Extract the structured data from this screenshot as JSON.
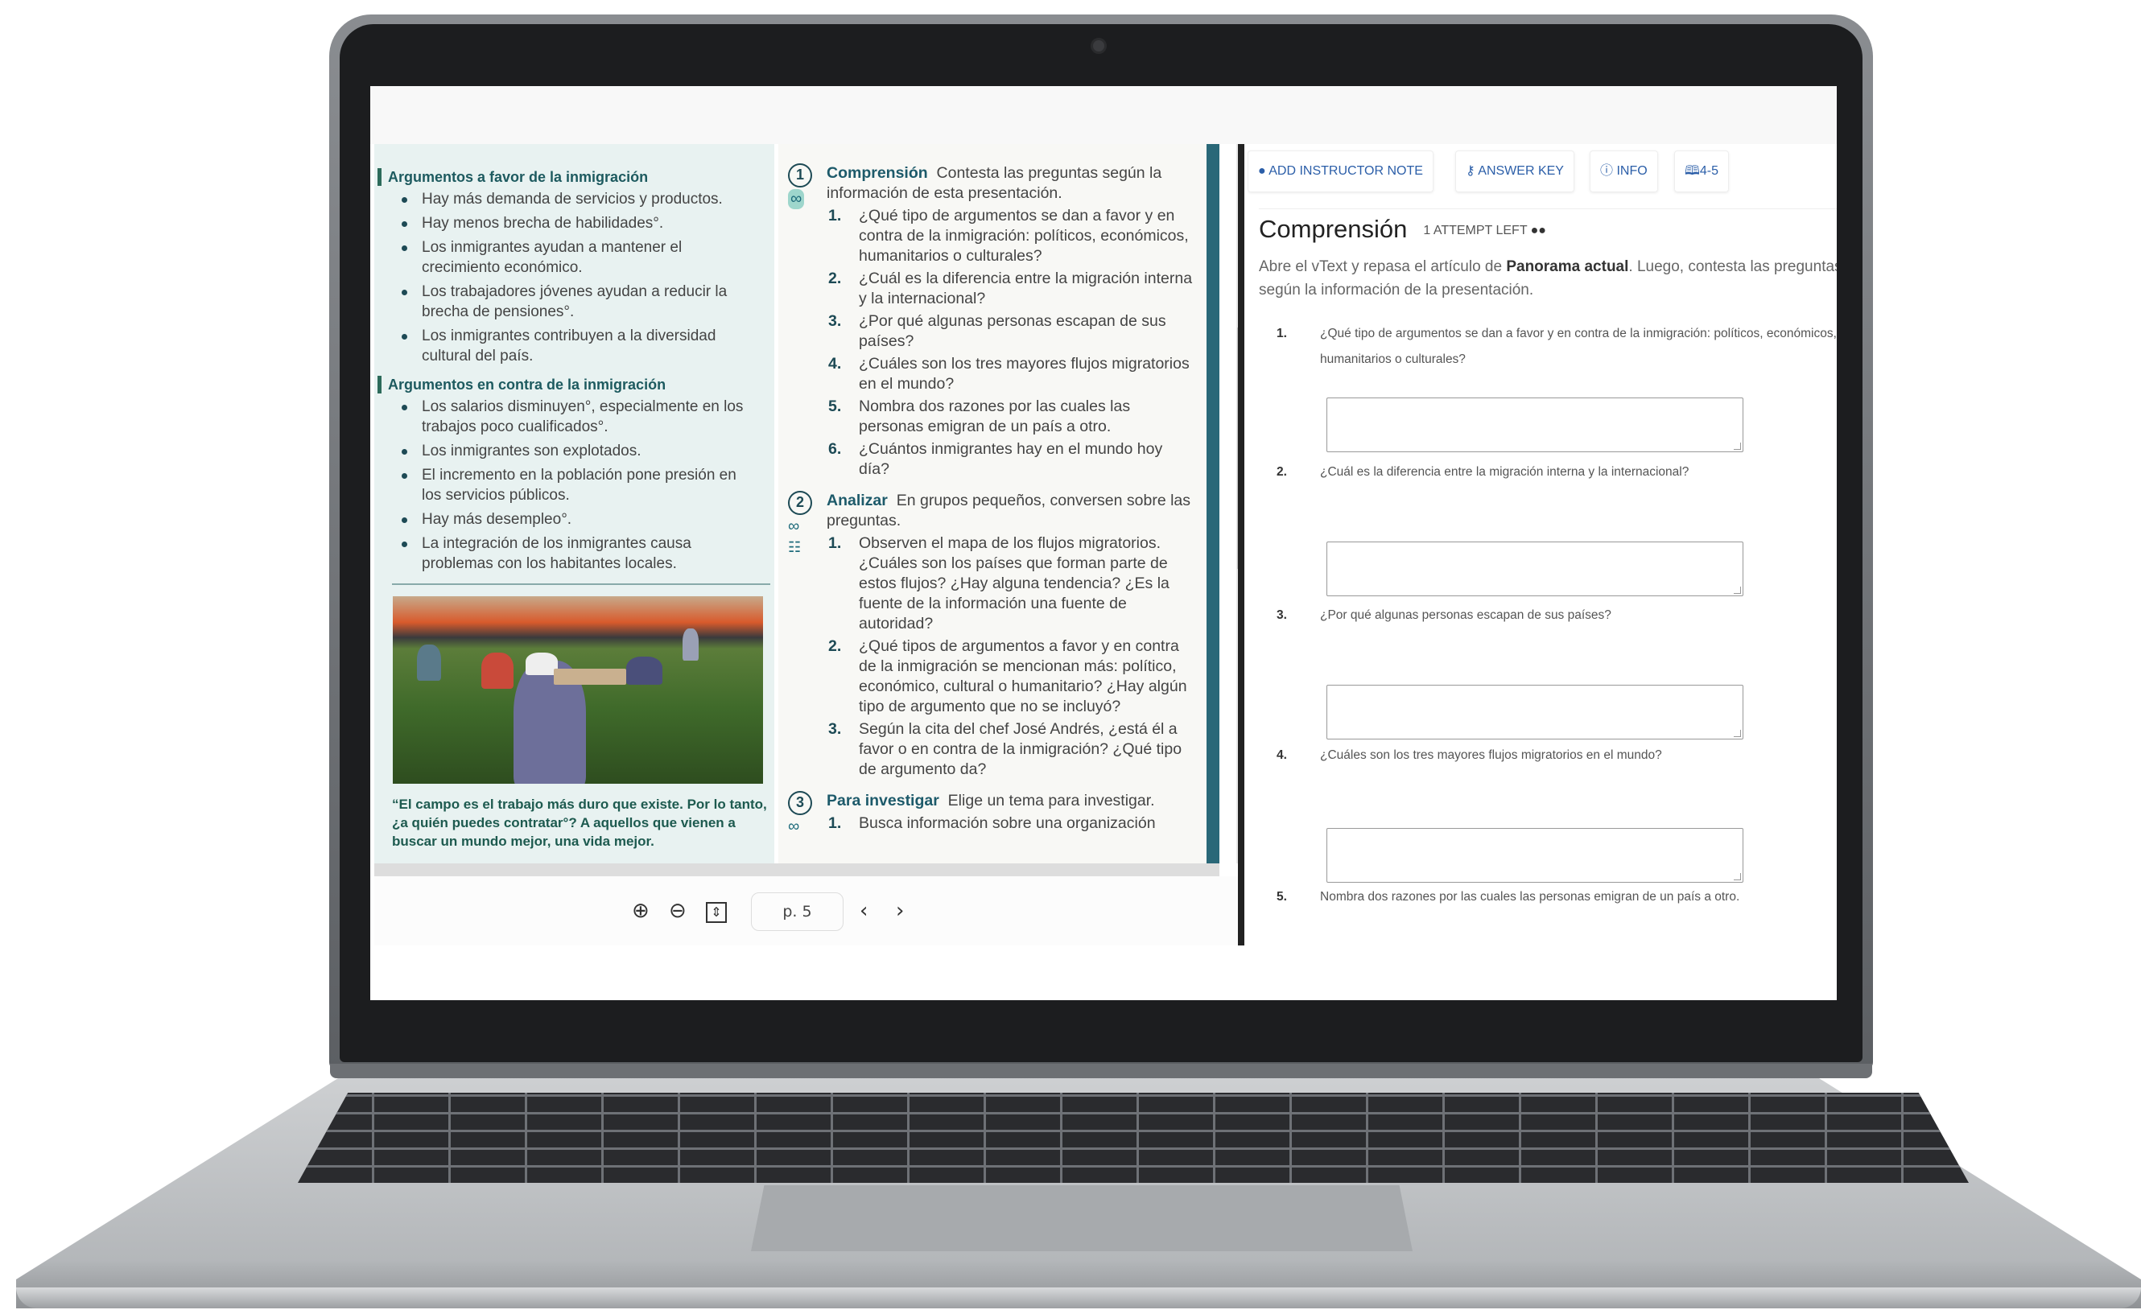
{
  "left_panel": {
    "for_heading": "Argumentos a favor de la inmigración",
    "for_items": [
      "Hay más demanda de servicios y productos.",
      "Hay menos brecha de habilidades°.",
      "Los inmigrantes ayudan a mantener el crecimiento económico.",
      "Los trabajadores jóvenes ayudan a reducir la brecha de pensiones°.",
      "Los inmigrantes contribuyen a la diversidad cultural del país."
    ],
    "against_heading": "Argumentos en contra de la inmigración",
    "against_items": [
      "Los salarios disminuyen°, especialmente en los trabajos poco cualificados°.",
      "Los inmigrantes son explotados.",
      "El incremento en la población pone presión en los servicios públicos.",
      "Hay más desempleo°.",
      "La integración de los inmigrantes causa problemas con los habitantes locales."
    ],
    "quote": "“El campo es el trabajo más duro que existe. Por lo tanto, ¿a quién puedes contratar°? A aquellos que vienen a buscar un mundo mejor, una vida mejor."
  },
  "middle_panel": {
    "sections": [
      {
        "num": "1",
        "title": "Comprensión",
        "intro": "Contesta las preguntas según la información de esta presentación.",
        "questions": [
          "¿Qué tipo de argumentos se dan a favor y en contra de la inmigración: políticos, económicos, humanitarios o culturales?",
          "¿Cuál es la diferencia entre la migración interna y la internacional?",
          "¿Por qué algunas personas escapan de sus países?",
          "¿Cuáles son los tres mayores flujos migratorios en el mundo?",
          "Nombra dos razones por las cuales las personas emigran de un país a otro.",
          "¿Cuántos inmigrantes hay en el mundo hoy día?"
        ]
      },
      {
        "num": "2",
        "title": "Analizar",
        "intro": "En grupos pequeños, conversen sobre las preguntas.",
        "questions": [
          "Observen el mapa de los flujos migratorios. ¿Cuáles son los países que forman parte de estos flujos? ¿Hay alguna tendencia? ¿Es la fuente de la información una fuente de autoridad?",
          "¿Qué tipos de argumentos a favor y en contra de la inmigración se mencionan más: político, económico, cultural o humanitario? ¿Hay algún tipo de argumento que no se incluyó?",
          "Según la cita del chef José Andrés, ¿está él a favor o en contra de la inmigración? ¿Qué tipo de argumento da?"
        ]
      },
      {
        "num": "3",
        "title": "Para investigar",
        "intro": "Elige un tema para investigar.",
        "questions": [
          "Busca información sobre una organización"
        ]
      }
    ]
  },
  "toolbar": {
    "page": "p. 5"
  },
  "right_panel": {
    "buttons": {
      "note": "ADD INSTRUCTOR NOTE",
      "key": "ANSWER KEY",
      "info": "INFO",
      "pages": "4-5"
    },
    "title": "Comprensión",
    "attempts": "1 ATTEMPT LEFT",
    "intro_pre": "Abre el vText y repasa el artículo de ",
    "intro_bold": "Panorama actual",
    "intro_post": ". Luego, contesta las preguntas según la información de la presentación.",
    "questions": [
      {
        "n": "1.",
        "text": "¿Qué tipo de argumentos se dan a favor y en contra de la inmigración: políticos, económicos, humanitarios o culturales?"
      },
      {
        "n": "2.",
        "text": "¿Cuál es la diferencia entre la migración interna y la internacional?"
      },
      {
        "n": "3.",
        "text": "¿Por qué algunas personas escapan de sus países?"
      },
      {
        "n": "4.",
        "text": "¿Cuáles son los tres mayores flujos migratorios en el mundo?"
      },
      {
        "n": "5.",
        "text": "Nombra dos razones por las cuales las personas emigran de un país a otro."
      }
    ]
  },
  "colors": {
    "teal_dark": "#1d5a5f",
    "link_blue": "#2b5ea8",
    "panel_bg": "#e8f2f1",
    "scroll_teal": "#2a6878"
  }
}
